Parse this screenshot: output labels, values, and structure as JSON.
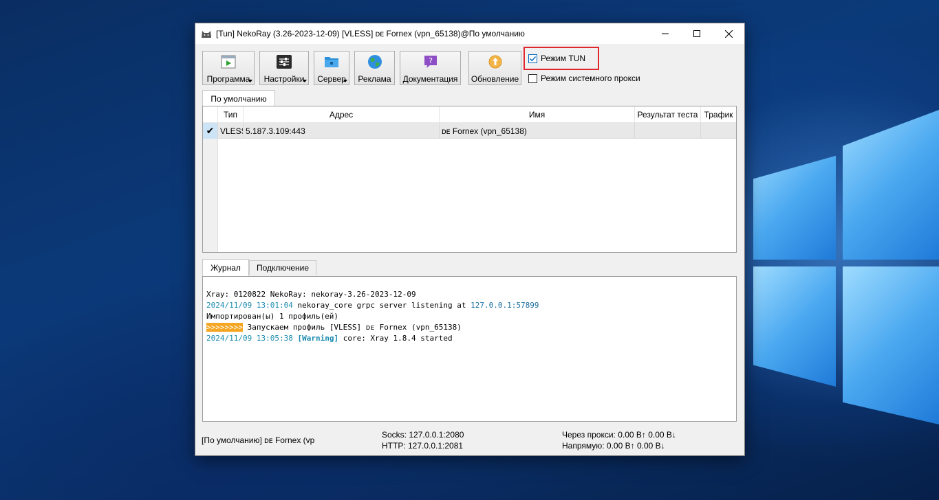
{
  "window": {
    "title": "[Tun] NekoRay (3.26-2023-12-09) [VLESS] ᴅᴇ Fornex (vpn_65138)@По умолчанию",
    "controls": {
      "minimize": "—",
      "maximize": "☐",
      "close": "✕"
    }
  },
  "toolbar": {
    "program": "Программа",
    "settings": "Настройки",
    "server": "Сервер",
    "ads": "Реклама",
    "docs": "Документация",
    "update": "Обновление"
  },
  "options": {
    "tun_mode": {
      "label": "Режим TUN",
      "checked": true
    },
    "system_proxy": {
      "label": "Режим системного прокси",
      "checked": false
    }
  },
  "groups": {
    "active_tab": "По умолчанию"
  },
  "profiles": {
    "columns": [
      "Тип",
      "Адрес",
      "Имя",
      "Результат теста",
      "Трафик"
    ],
    "rows": [
      {
        "marker": "✔",
        "type": "VLESS",
        "address": "5.187.3.109:443",
        "name": "ᴅᴇ Fornex (vpn_65138)",
        "test": "",
        "traffic": ""
      }
    ]
  },
  "bottom_tabs": {
    "log": "Журнал",
    "connection": "Подключение"
  },
  "log": {
    "line1": "Xray: 0120822 NekoRay: nekoray-3.26-2023-12-09",
    "line2_ts": "2024/11/09 13:01:04",
    "line2_text": " nekoray_core grpc server listening at ",
    "line2_ip": "127.0.0.1:57899",
    "line3": "Импортирован(ы) 1 профиль(ей)",
    "line4_arrows": ">>>>>>>>",
    "line4_text": " Запускаем профиль [VLESS] ᴅᴇ Fornex (vpn_65138)",
    "line5_ts": "2024/11/09 13:05:38",
    "line5_tag": "[Warning]",
    "line5_text": " core: Xray 1.8.4 started"
  },
  "statusbar": {
    "profile": "[По умолчанию] ᴅᴇ Fornex (vp",
    "socks": "Socks: 127.0.0.1:2080",
    "http": "HTTP: 127.0.0.1:2081",
    "via_proxy": "Через прокси: 0.00 B↑ 0.00 B↓",
    "direct": "Напрямую: 0.00 B↑ 0.00 B↓"
  },
  "colors": {
    "highlight": "#e0272e",
    "accent": "#0067c0",
    "warn_bg": "#f5a623",
    "log_teal": "#1a8bb0"
  }
}
